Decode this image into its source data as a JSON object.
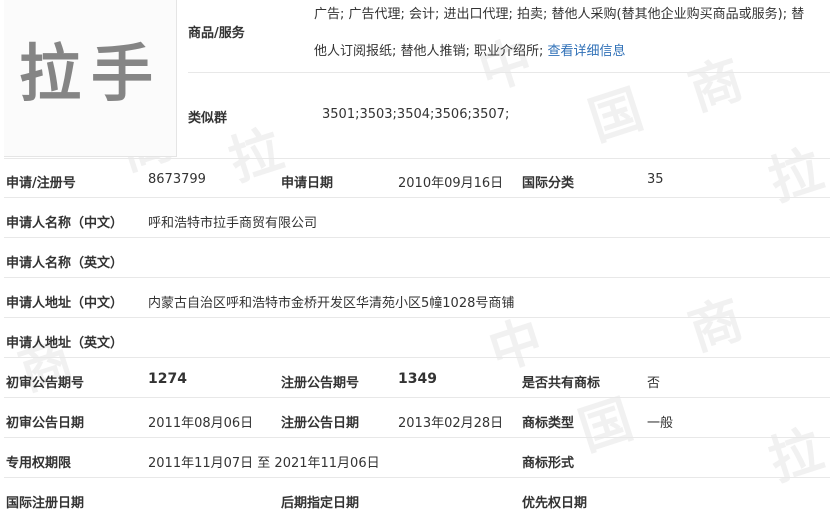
{
  "logo": {
    "text": "拉手"
  },
  "goods": {
    "label": "商品/服务",
    "line1": "广告; 广告代理; 会计; 进出口代理; 拍卖; 替他人采购(替其他企业购买商品或服务); 替",
    "line2": "他人订阅报纸; 替他人推销; 职业介绍所;",
    "link": "查看详细信息"
  },
  "similar": {
    "label": "类似群",
    "value": "3501;3503;3504;3506;3507;"
  },
  "rows": [
    {
      "l1": "申请/注册号",
      "v1": "8673799",
      "l2": "申请日期",
      "v2": "2010年09月16日",
      "l3": "国际分类",
      "v3": "35"
    },
    {
      "l1": "申请人名称（中文）",
      "v1": "呼和浩特市拉手商贸有限公司"
    },
    {
      "l1": "申请人名称（英文）",
      "v1": ""
    },
    {
      "l1": "申请人地址（中文）",
      "v1": "内蒙古自治区呼和浩特市金桥开发区华清苑小区5幢1028号商铺"
    },
    {
      "l1": "申请人地址（英文）",
      "v1": ""
    },
    {
      "l1": "初审公告期号",
      "v1": "1274",
      "l2": "注册公告期号",
      "v2": "1349",
      "l3": "是否共有商标",
      "v3": "否"
    },
    {
      "l1": "初审公告日期",
      "v1": "2011年08月06日",
      "l2": "注册公告日期",
      "v2": "2013年02月28日",
      "l3": "商标类型",
      "v3": "一般"
    },
    {
      "l1": "专用权期限",
      "v1": "2011年11月07日 至 2021年11月06日",
      "l3": "商标形式",
      "v3": ""
    },
    {
      "l1": "国际注册日期",
      "v1": "",
      "l2": "后期指定日期",
      "v2": "",
      "l3": "优先权日期",
      "v3": ""
    }
  ],
  "watermark": {
    "chars": [
      "中",
      "国",
      "商",
      "拉"
    ]
  },
  "colors": {
    "link": "#2f70b7",
    "text": "#333333",
    "divider": "#e8e8e8",
    "watermark": "#f1f1f1"
  }
}
